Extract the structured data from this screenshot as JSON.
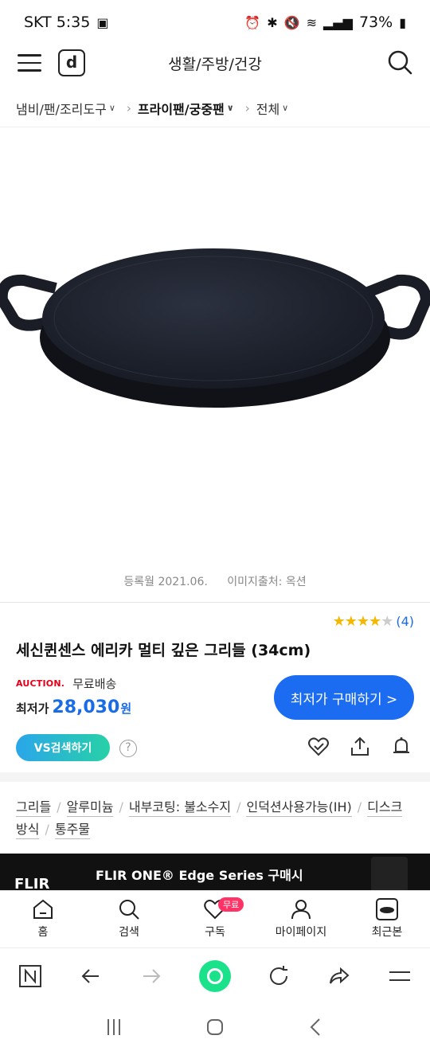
{
  "status": {
    "carrier_time": "SKT 5:35",
    "battery": "73%"
  },
  "nav": {
    "logo": "d",
    "title": "생활/주방/건강"
  },
  "breadcrumb": [
    {
      "label": "냄비/팬/조리도구"
    },
    {
      "label": "프라이팬/궁중팬"
    },
    {
      "label": "전체"
    }
  ],
  "image": {
    "registered": "등록월 2021.06.",
    "source": "이미지출처: 옥션"
  },
  "product": {
    "rating": 4,
    "rating_max": 5,
    "review_count": "(4)",
    "title": "세신퀸센스 에리카 멀티 깊은 그리들 (34cm)",
    "seller_logo": "AUCTION.",
    "shipping": "무료배송",
    "price_label": "최저가",
    "price": "28,030",
    "price_unit": "원",
    "buy_button": "최저가 구매하기 >",
    "vs_button": "VS검색하기",
    "help": "?"
  },
  "tags": [
    "그리들",
    "알루미늄",
    "내부코팅: 불소수지",
    "인덕션사용가능(IH)",
    "디스크방식",
    "통주물"
  ],
  "ad": {
    "brand": "FLIR",
    "text": "FLIR ONE® Edge Series 구매시"
  },
  "bottom_tabs": [
    {
      "label": "홈",
      "icon": "home-icon"
    },
    {
      "label": "검색",
      "icon": "search-icon"
    },
    {
      "label": "구독",
      "icon": "heart-check-icon",
      "badge": "무료"
    },
    {
      "label": "마이페이지",
      "icon": "user-icon"
    },
    {
      "label": "최근본",
      "icon": "recent-pan-icon"
    }
  ],
  "colors": {
    "accent": "#1b6cf0",
    "star": "#f5b800",
    "auction": "#e4001b",
    "badge": "#ff3366",
    "naver_green": "#19e28a"
  }
}
